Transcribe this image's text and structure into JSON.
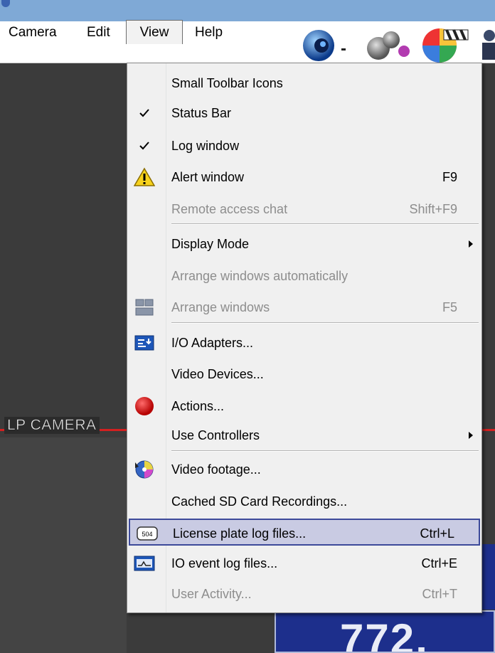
{
  "menubar": {
    "items": [
      {
        "label": "Camera"
      },
      {
        "label": "Edit"
      },
      {
        "label": "View"
      },
      {
        "label": "Help"
      }
    ]
  },
  "view_menu": {
    "items": [
      {
        "label": "Small Toolbar Icons",
        "shortcut": "",
        "checked": false,
        "disabled": false
      },
      {
        "label": "Status Bar",
        "shortcut": "",
        "checked": true,
        "disabled": false
      },
      {
        "label": "Log window",
        "shortcut": "",
        "checked": true,
        "disabled": false
      },
      {
        "label": "Alert window",
        "shortcut": "F9",
        "icon": "warning-icon",
        "disabled": false
      },
      {
        "label": "Remote access chat",
        "shortcut": "Shift+F9",
        "disabled": true
      },
      {
        "label": "Display Mode",
        "shortcut": "",
        "submenu": true,
        "disabled": false
      },
      {
        "label": "Arrange windows automatically",
        "shortcut": "",
        "disabled": true
      },
      {
        "label": "Arrange windows",
        "shortcut": "F5",
        "icon": "grid-layout-icon",
        "disabled": true
      },
      {
        "label": "I/O Adapters...",
        "shortcut": "",
        "icon": "io-adapter-icon",
        "disabled": false
      },
      {
        "label": "Video Devices...",
        "shortcut": "",
        "disabled": false
      },
      {
        "label": "Actions...",
        "shortcut": "",
        "icon": "red-circle-icon",
        "disabled": false
      },
      {
        "label": "Use Controllers",
        "shortcut": "",
        "submenu": true,
        "disabled": false
      },
      {
        "label": "Video footage...",
        "shortcut": "",
        "icon": "video-disc-icon",
        "disabled": false
      },
      {
        "label": "Cached SD Card Recordings...",
        "shortcut": "",
        "disabled": false
      },
      {
        "label": "License plate log files...",
        "shortcut": "Ctrl+L",
        "icon": "license-plate-icon",
        "highlighted": true,
        "disabled": false
      },
      {
        "label": "IO event log files...",
        "shortcut": "Ctrl+E",
        "icon": "io-log-icon",
        "disabled": false
      },
      {
        "label": "User Activity...",
        "shortcut": "Ctrl+T",
        "disabled": true
      }
    ]
  },
  "camera_panel": {
    "label": "LP CAMERA",
    "plate_reading": "772,"
  },
  "colors": {
    "highlight_bg": "#c9cbe3",
    "highlight_border": "#3d4a9a",
    "disabled_text": "#8d8d8d",
    "accent_red": "#d42020",
    "plate_blue": "#1d2f8c"
  }
}
